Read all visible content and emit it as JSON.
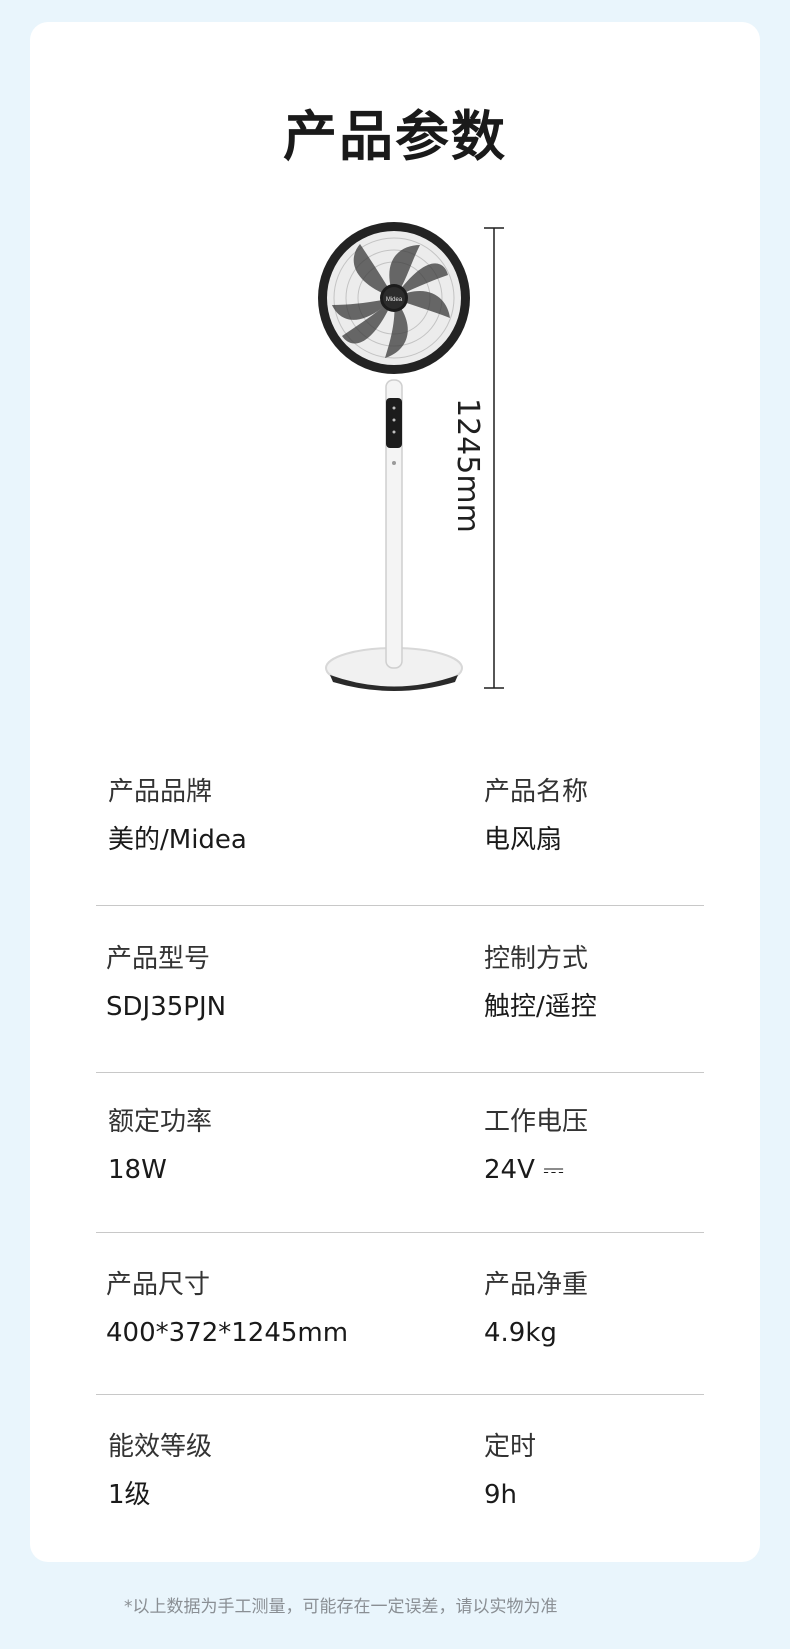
{
  "page": {
    "title": "产品参数",
    "height_label": "1245mm",
    "footnote": "*以上数据为手工测量，可能存在一定误差，请以实物为准"
  },
  "specs": [
    {
      "left": {
        "label": "产品品牌",
        "value": "美的/Midea"
      },
      "right": {
        "label": "产品名称",
        "value": "电风扇"
      }
    },
    {
      "left": {
        "label": "产品型号",
        "value": "SDJ35PJN"
      },
      "right": {
        "label": "控制方式",
        "value": "触控/遥控"
      }
    },
    {
      "left": {
        "label": "额定功率",
        "value": "18W"
      },
      "right": {
        "label": "工作电压",
        "value": "24V ⎓"
      }
    },
    {
      "left": {
        "label": "产品尺寸",
        "value": "400*372*1245mm"
      },
      "right": {
        "label": "产品净重",
        "value": "4.9kg"
      }
    },
    {
      "left": {
        "label": "能效等级",
        "value": "1级"
      },
      "right": {
        "label": "定时",
        "value": "9h"
      }
    }
  ],
  "colors": {
    "background": "#e9f5fc",
    "card": "#ffffff",
    "divider": "#c8c8c8",
    "footnote": "#8a8f94"
  }
}
